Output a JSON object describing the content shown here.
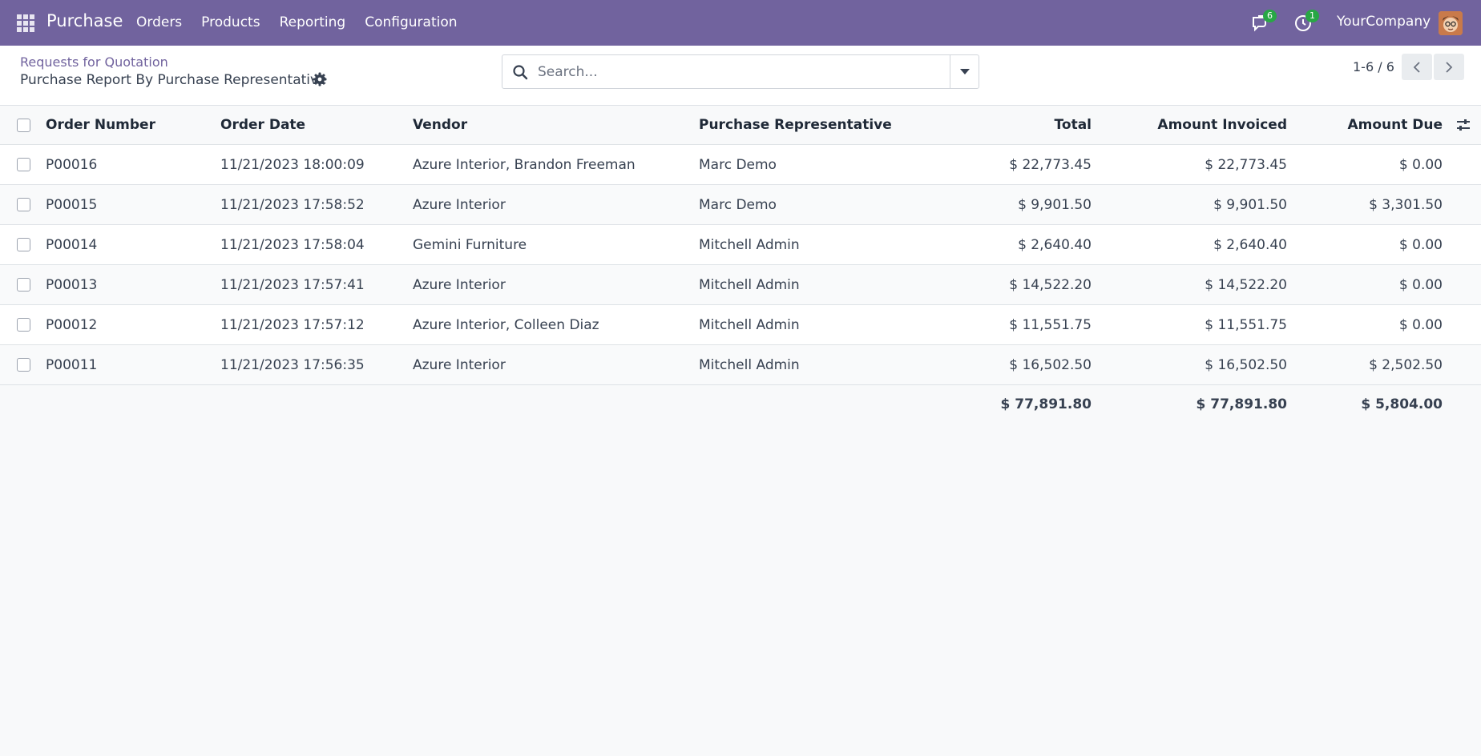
{
  "navbar": {
    "brand": "Purchase",
    "menu": [
      {
        "label": "Orders"
      },
      {
        "label": "Products"
      },
      {
        "label": "Reporting"
      },
      {
        "label": "Configuration"
      }
    ],
    "messages_count": "6",
    "activities_count": "1",
    "company": "YourCompany",
    "color": "#71639e"
  },
  "control_panel": {
    "breadcrumb": "Requests for Quotation",
    "title": "Purchase Report By Purchase Representative",
    "search_placeholder": "Search...",
    "pager": "1-6 / 6"
  },
  "table": {
    "columns": {
      "order_number": "Order Number",
      "order_date": "Order Date",
      "vendor": "Vendor",
      "representative": "Purchase Representative",
      "total": "Total",
      "amount_invoiced": "Amount Invoiced",
      "amount_due": "Amount Due"
    },
    "rows": [
      {
        "order_number": "P00016",
        "order_date": "11/21/2023 18:00:09",
        "vendor": "Azure Interior, Brandon Freeman",
        "representative": "Marc Demo",
        "total": "$ 22,773.45",
        "amount_invoiced": "$ 22,773.45",
        "amount_due": "$ 0.00"
      },
      {
        "order_number": "P00015",
        "order_date": "11/21/2023 17:58:52",
        "vendor": "Azure Interior",
        "representative": "Marc Demo",
        "total": "$ 9,901.50",
        "amount_invoiced": "$ 9,901.50",
        "amount_due": "$ 3,301.50"
      },
      {
        "order_number": "P00014",
        "order_date": "11/21/2023 17:58:04",
        "vendor": "Gemini Furniture",
        "representative": "Mitchell Admin",
        "total": "$ 2,640.40",
        "amount_invoiced": "$ 2,640.40",
        "amount_due": "$ 0.00"
      },
      {
        "order_number": "P00013",
        "order_date": "11/21/2023 17:57:41",
        "vendor": "Azure Interior",
        "representative": "Mitchell Admin",
        "total": "$ 14,522.20",
        "amount_invoiced": "$ 14,522.20",
        "amount_due": "$ 0.00"
      },
      {
        "order_number": "P00012",
        "order_date": "11/21/2023 17:57:12",
        "vendor": "Azure Interior, Colleen Diaz",
        "representative": "Mitchell Admin",
        "total": "$ 11,551.75",
        "amount_invoiced": "$ 11,551.75",
        "amount_due": "$ 0.00"
      },
      {
        "order_number": "P00011",
        "order_date": "11/21/2023 17:56:35",
        "vendor": "Azure Interior",
        "representative": "Mitchell Admin",
        "total": "$ 16,502.50",
        "amount_invoiced": "$ 16,502.50",
        "amount_due": "$ 2,502.50"
      }
    ],
    "totals": {
      "total": "$ 77,891.80",
      "amount_invoiced": "$ 77,891.80",
      "amount_due": "$ 5,804.00"
    }
  }
}
